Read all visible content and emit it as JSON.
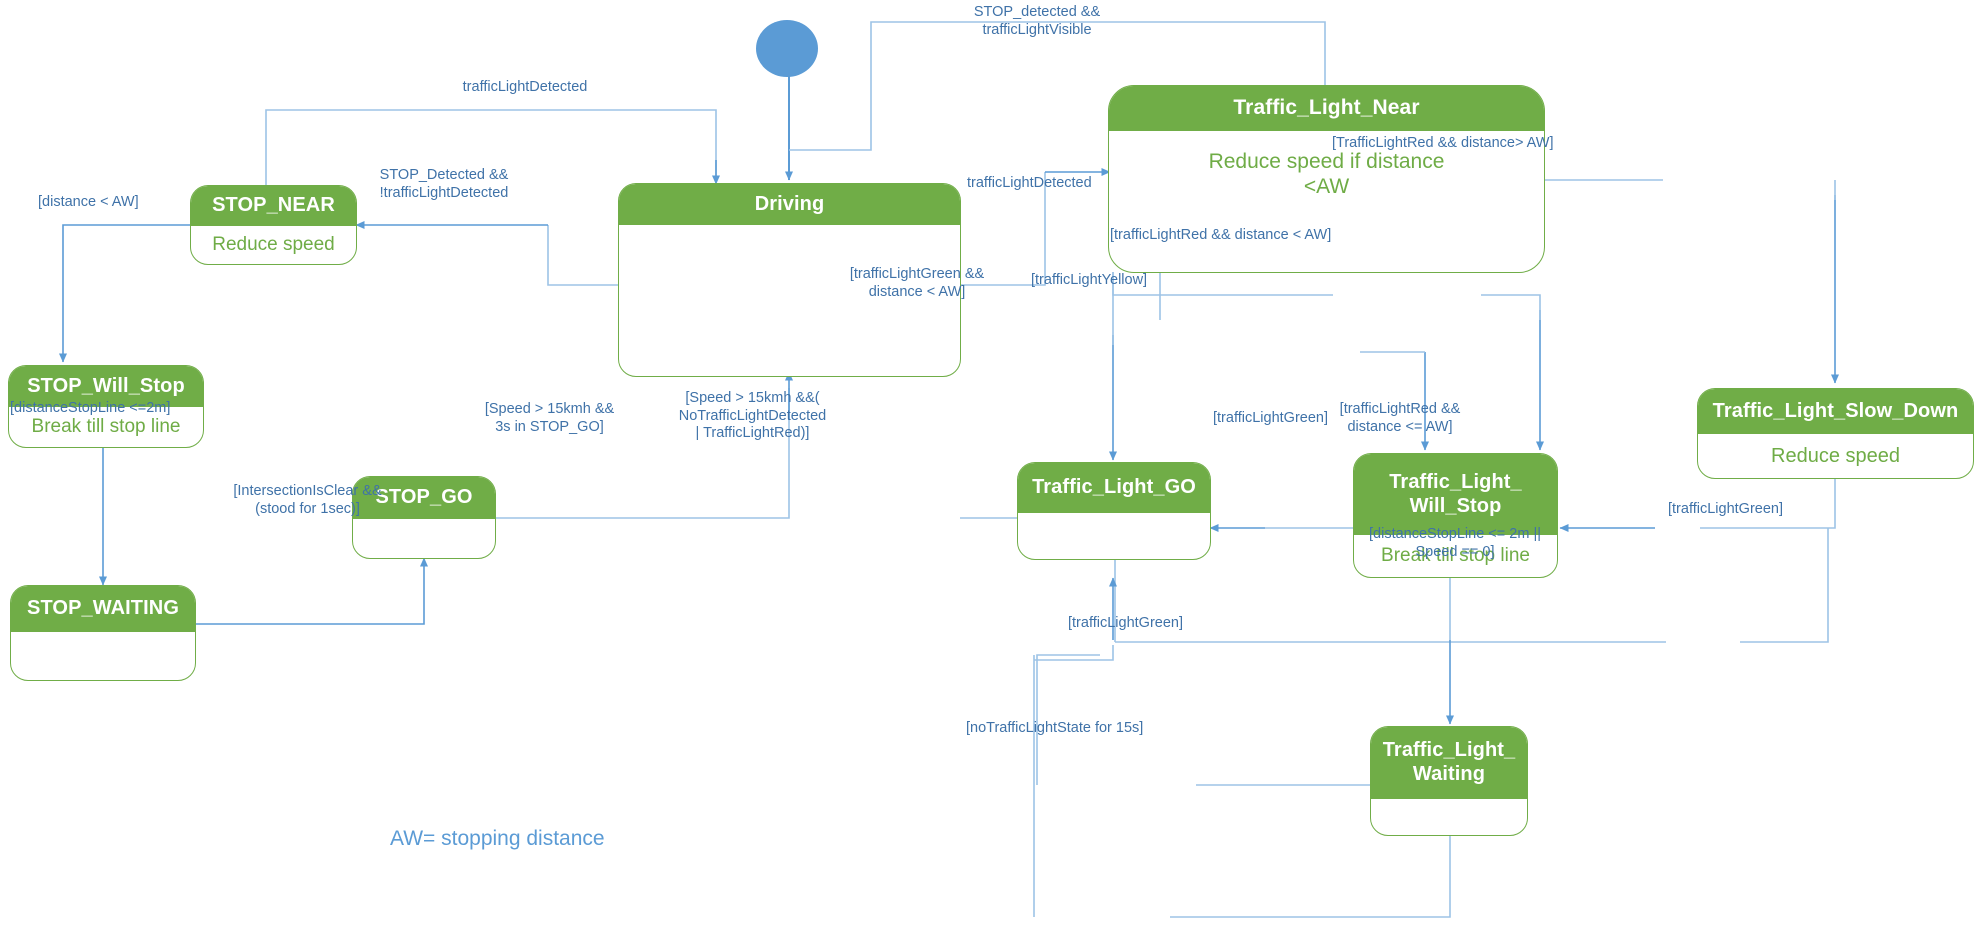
{
  "diagram": {
    "type": "state-machine",
    "legend": "AW= stopping distance",
    "colors": {
      "state_fill": "#70AD47",
      "state_border": "#70AD47",
      "state_body_text": "#6FAC46",
      "transition_line": "#5B9BD5",
      "transition_label": "#3F72A8",
      "initial_node": "#5B9BD5"
    },
    "initial_node": "initial-state"
  },
  "states": [
    {
      "id": "stop_near",
      "name": "STOP_NEAR",
      "action": "Reduce speed"
    },
    {
      "id": "driving",
      "name": "Driving",
      "action": ""
    },
    {
      "id": "traffic_light_near",
      "name": "Traffic_Light_Near",
      "action": "Reduce speed if distance\n<AW"
    },
    {
      "id": "traffic_light_slow_down",
      "name": "Traffic_Light_Slow_Down",
      "action": "Reduce speed"
    },
    {
      "id": "stop_will_stop",
      "name": "STOP_Will_Stop",
      "action": "Break till stop line"
    },
    {
      "id": "stop_go",
      "name": "STOP_GO",
      "action": ""
    },
    {
      "id": "traffic_light_go",
      "name": "Traffic_Light_GO",
      "action": ""
    },
    {
      "id": "traffic_light_will_stop",
      "name": "Traffic_Light_\nWill_Stop",
      "action": "Break till stop line"
    },
    {
      "id": "stop_waiting",
      "name": "STOP_WAITING",
      "action": ""
    },
    {
      "id": "traffic_light_waiting",
      "name": "Traffic_Light_\nWaiting",
      "action": ""
    }
  ],
  "transitions": [
    {
      "id": "t1",
      "from": "initial-state",
      "to": "driving",
      "label": ""
    },
    {
      "id": "t2",
      "from": "driving",
      "to": "traffic_light_near",
      "label": "STOP_detected &&\ntrafficLightVisible"
    },
    {
      "id": "t3",
      "from": "stop_near",
      "to": "driving",
      "label": "trafficLightDetected"
    },
    {
      "id": "t4",
      "from": "driving",
      "to": "stop_near",
      "label": "STOP_Detected &&\n!trafficLightDetected"
    },
    {
      "id": "t5",
      "from": "driving",
      "to": "traffic_light_near",
      "label": "trafficLightDetected"
    },
    {
      "id": "t6",
      "from": "stop_near",
      "to": "stop_will_stop",
      "label": "[distance < AW]"
    },
    {
      "id": "t7",
      "from": "stop_will_stop",
      "to": "stop_waiting",
      "label": "[distanceStopLine <=2m]"
    },
    {
      "id": "t8",
      "from": "stop_waiting",
      "to": "stop_go",
      "label": "[IntersectionIsClear &&\n(stood for 1sec)]"
    },
    {
      "id": "t9",
      "from": "stop_go",
      "to": "driving",
      "label": "[Speed > 15kmh &&\n3s in STOP_GO]"
    },
    {
      "id": "t10",
      "from": "traffic_light_go",
      "to": "driving",
      "label": "[Speed > 15kmh &&(\nNoTrafficLightDetected\n| TrafficLightRed)]"
    },
    {
      "id": "t11",
      "from": "traffic_light_near",
      "to": "traffic_light_go",
      "label": "[trafficLightGreen &&\ndistance < AW]"
    },
    {
      "id": "t12",
      "from": "traffic_light_near",
      "to": "traffic_light_will_stop",
      "label": "[trafficLightYellow]"
    },
    {
      "id": "t13",
      "from": "traffic_light_near",
      "to": "traffic_light_will_stop",
      "label": "[trafficLightRed && distance < AW]"
    },
    {
      "id": "t14",
      "from": "traffic_light_near",
      "to": "traffic_light_slow_down",
      "label": "[TrafficLightRed && distance> AW]"
    },
    {
      "id": "t15",
      "from": "traffic_light_slow_down",
      "to": "traffic_light_will_stop",
      "label": "[trafficLightRed &&\ndistance <= AW]"
    },
    {
      "id": "t16",
      "from": "traffic_light_slow_down",
      "to": "traffic_light_go",
      "label": "[trafficLightGreen]"
    },
    {
      "id": "t17",
      "from": "traffic_light_will_stop",
      "to": "traffic_light_go",
      "label": "[trafficLightGreen]"
    },
    {
      "id": "t18",
      "from": "traffic_light_will_stop",
      "to": "traffic_light_waiting",
      "label": "[distanceStopLine <= 2m ||\nSpeed == 0]"
    },
    {
      "id": "t19",
      "from": "traffic_light_waiting",
      "to": "traffic_light_go",
      "label": "[trafficLightGreen]"
    },
    {
      "id": "t20",
      "from": "traffic_light_waiting",
      "to": "traffic_light_go",
      "label": "[noTrafficLightState for 15s]"
    }
  ]
}
